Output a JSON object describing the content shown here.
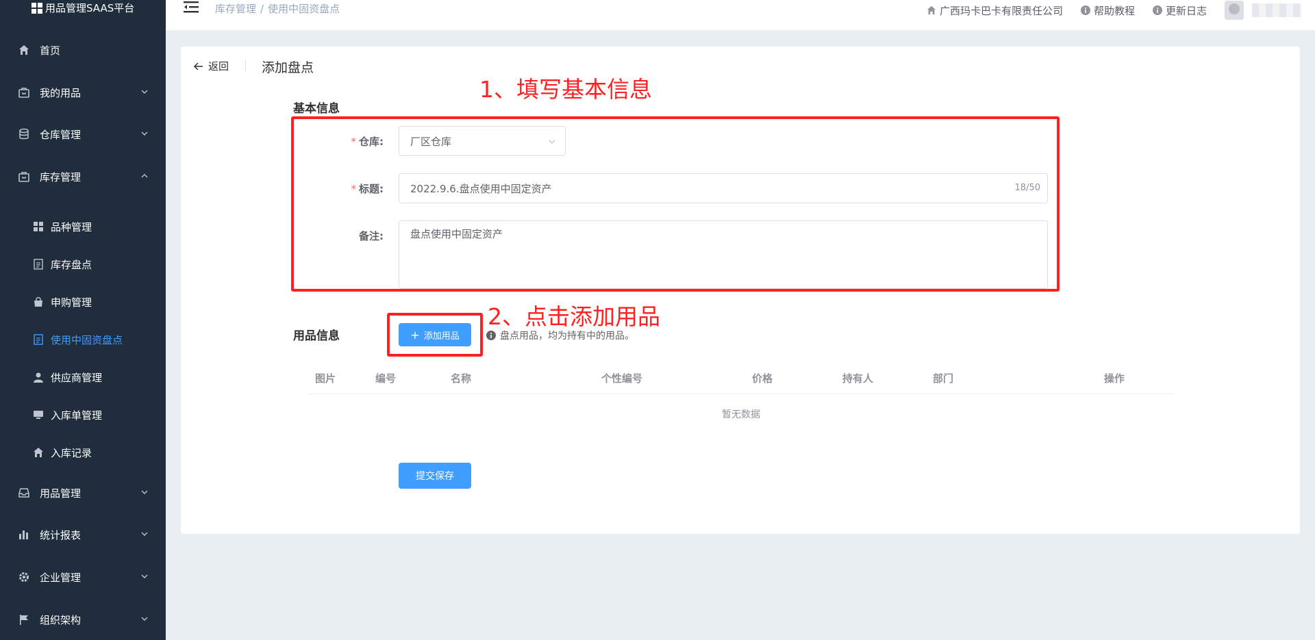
{
  "app": {
    "brand": "用品管理SAAS平台"
  },
  "sidebar": {
    "items": [
      {
        "label": "首页",
        "icon": "home-icon"
      },
      {
        "label": "我的用品",
        "icon": "bag-icon"
      },
      {
        "label": "仓库管理",
        "icon": "database-icon"
      },
      {
        "label": "库存管理",
        "icon": "bag-icon"
      },
      {
        "label": "用品管理",
        "icon": "inbox-icon"
      },
      {
        "label": "统计报表",
        "icon": "bar-chart-icon"
      },
      {
        "label": "企业管理",
        "icon": "gear-icon"
      },
      {
        "label": "组织架构",
        "icon": "flag-icon"
      }
    ],
    "sub_items": [
      {
        "label": "品种管理",
        "icon": "grid-icon"
      },
      {
        "label": "库存盘点",
        "icon": "document-icon"
      },
      {
        "label": "申购管理",
        "icon": "shopping-bag-icon"
      },
      {
        "label": "使用中固资盘点",
        "icon": "document-icon"
      },
      {
        "label": "供应商管理",
        "icon": "user-icon"
      },
      {
        "label": "入库单管理",
        "icon": "monitor-icon"
      },
      {
        "label": "入库记录",
        "icon": "home-icon"
      }
    ]
  },
  "header": {
    "breadcrumb": [
      "库存管理",
      "使用中固资盘点"
    ],
    "breadcrumb_separator": "/",
    "company": "广西玛卡巴卡有限责任公司",
    "help": "帮助教程",
    "changelog": "更新日志"
  },
  "page": {
    "back_label": "返回",
    "title": "添加盘点"
  },
  "form": {
    "basic_title": "基本信息",
    "warehouse_label": "仓库:",
    "warehouse_value": "厂区仓库",
    "title_label": "标题:",
    "title_value": "2022.9.6.盘点使用中固定资产",
    "title_count": "18/50",
    "remark_label": "备注:",
    "remark_value": "盘点使用中固定资产",
    "required_mark": "*"
  },
  "items": {
    "section_title": "用品信息",
    "add_button": "添加用品",
    "add_button_glyph": "+",
    "hint": "盘点用品，均为持有中的用品。",
    "columns": [
      "图片",
      "编号",
      "名称",
      "个性编号",
      "价格",
      "持有人",
      "部门",
      "操作"
    ],
    "empty_text": "暂无数据"
  },
  "submit_label": "提交保存",
  "annotations": {
    "step1": "1、填写基本信息",
    "step2": "2、点击添加用品"
  },
  "colors": {
    "sidebar_bg": "#1f2d3d",
    "accent": "#409eff",
    "annotation_red": "#ff2121"
  }
}
